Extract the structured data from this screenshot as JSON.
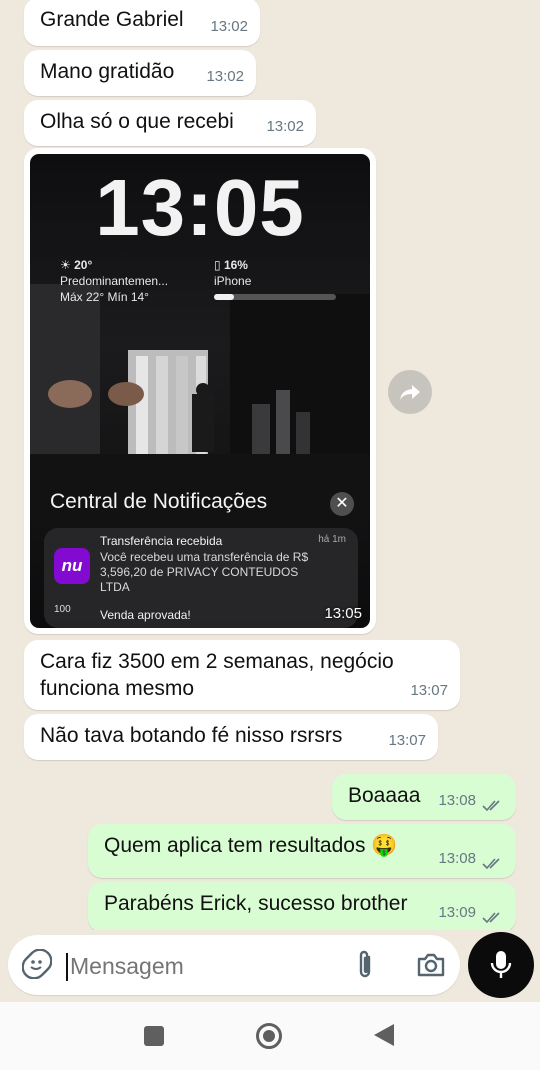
{
  "messages_in": [
    {
      "text": "Grande Gabriel",
      "time": "13:02"
    },
    {
      "text": "Mano gratidão",
      "time": "13:02"
    },
    {
      "text": "Olha só o que recebi",
      "time": "13:02"
    },
    {
      "text": "Cara fiz 3500 em 2 semanas, negócio funciona mesmo",
      "time": "13:07"
    },
    {
      "text": "Não tava botando fé nisso rsrsrs",
      "time": "13:07"
    }
  ],
  "image_message": {
    "time": "13:05",
    "lock_clock": "13:05",
    "weather": {
      "temp": "20°",
      "condition": "Predominantemen...",
      "range": "Máx 22° Mín 14°"
    },
    "battery": {
      "percent": "16%",
      "device": "iPhone",
      "level": 0.16
    },
    "notification_center": "Central de Notificações",
    "notifications": [
      {
        "app_icon": "nu",
        "title": "Transferência recebida",
        "age": "há 1m",
        "body": "Você recebeu uma transferência de R$ 3,596,20 de PRIVACY CONTEUDOS LTDA"
      },
      {
        "app_icon": "100",
        "title": "Venda aprovada!"
      }
    ]
  },
  "messages_out": [
    {
      "text": "Boaaaa",
      "time": "13:08"
    },
    {
      "text": "Quem aplica tem resultados 🤑",
      "time": "13:08"
    },
    {
      "text": "Parabéns Erick, sucesso brother",
      "time": "13:09"
    }
  ],
  "composer": {
    "placeholder": "Mensagem"
  },
  "icons": {
    "emoji": "sticker-icon",
    "attach": "paperclip-icon",
    "camera": "camera-icon",
    "mic": "microphone-icon",
    "forward": "forward-icon",
    "nav": [
      "recents-square-icon",
      "home-circle-icon",
      "back-triangle-icon"
    ]
  },
  "colors": {
    "incoming": "#ffffff",
    "outgoing": "#d9fdd3",
    "background": "#efe8dd",
    "read_ticks": "#667781"
  }
}
